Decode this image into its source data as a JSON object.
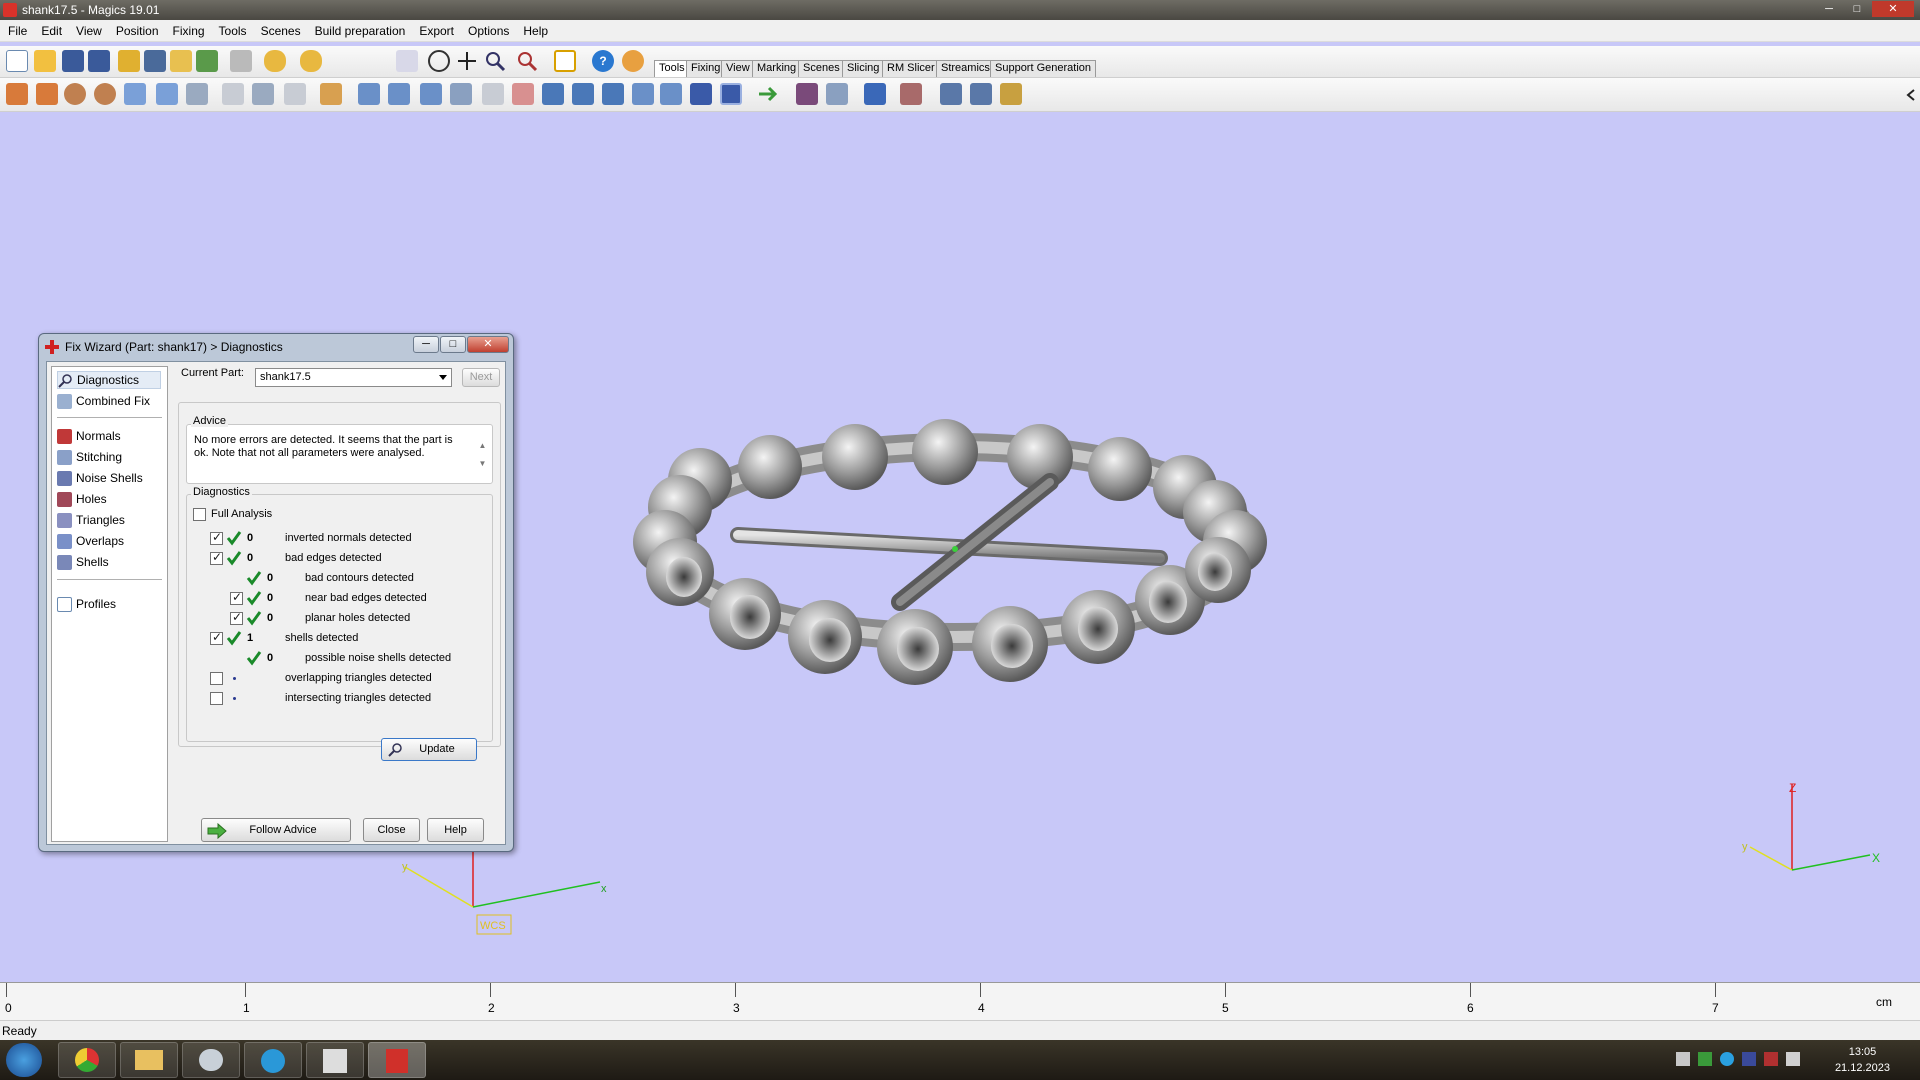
{
  "window": {
    "title": "shank17.5 - Magics 19.01"
  },
  "menu": [
    "File",
    "Edit",
    "View",
    "Position",
    "Fixing",
    "Tools",
    "Scenes",
    "Build preparation",
    "Export",
    "Options",
    "Help"
  ],
  "toolbar_tabs": [
    "Tools",
    "Fixing",
    "View",
    "Marking",
    "Scenes",
    "Slicing",
    "RM Slicer",
    "Streamics",
    "Support Generation"
  ],
  "active_tab": "Tools",
  "dialog": {
    "title": "Fix Wizard (Part: shank17) > Diagnostics",
    "nav": {
      "diagnostics": "Diagnostics",
      "combined_fix": "Combined Fix",
      "normals": "Normals",
      "stitching": "Stitching",
      "noise_shells": "Noise Shells",
      "holes": "Holes",
      "triangles": "Triangles",
      "overlaps": "Overlaps",
      "shells": "Shells",
      "profiles": "Profiles"
    },
    "current_part_label": "Current Part:",
    "current_part_value": "shank17.5",
    "next_label": "Next",
    "advice_title": "Advice",
    "advice_text": "No more errors are detected. It seems that the part is ok. Note that not all parameters were analysed.",
    "diagnostics_title": "Diagnostics",
    "full_analysis_label": "Full Analysis",
    "rows": [
      {
        "count": "0",
        "label": "inverted normals detected"
      },
      {
        "count": "0",
        "label": "bad edges detected"
      },
      {
        "count": "0",
        "label": "bad contours detected"
      },
      {
        "count": "0",
        "label": "near bad edges detected"
      },
      {
        "count": "0",
        "label": "planar holes detected"
      },
      {
        "count": "1",
        "label": "shells detected"
      },
      {
        "count": "0",
        "label": "possible noise shells detected"
      },
      {
        "count": "",
        "label": "overlapping triangles detected"
      },
      {
        "count": "",
        "label": "intersecting triangles detected"
      }
    ],
    "update_label": "Update",
    "follow_advice_label": "Follow Advice",
    "close_label": "Close",
    "help_label": "Help"
  },
  "axes": {
    "wcs_label": "WCS",
    "x": "x",
    "y": "y",
    "z": "Z",
    "y2": "y",
    "x2": "X"
  },
  "ruler": {
    "labels": [
      "0",
      "1",
      "2",
      "3",
      "4",
      "5",
      "6",
      "7"
    ],
    "unit": "cm"
  },
  "status": "Ready",
  "clock": {
    "time": "13:05",
    "date": "21.12.2023"
  }
}
